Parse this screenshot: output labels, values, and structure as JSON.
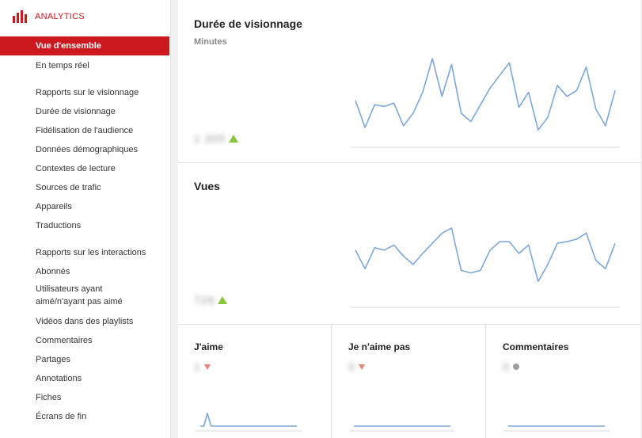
{
  "app": {
    "brand": "ANALYTICS"
  },
  "sidebar": {
    "items": [
      {
        "label": "Vue d'ensemble",
        "active": true
      },
      {
        "label": "En temps réel"
      },
      {
        "label": "Rapports sur le visionnage",
        "heading": true
      },
      {
        "label": "Durée de visionnage"
      },
      {
        "label": "Fidélisation de l'audience"
      },
      {
        "label": "Données démographiques"
      },
      {
        "label": "Contextes de lecture"
      },
      {
        "label": "Sources de trafic"
      },
      {
        "label": "Appareils"
      },
      {
        "label": "Traductions"
      },
      {
        "label": "Rapports sur les interactions",
        "heading": true
      },
      {
        "label": "Abonnés"
      },
      {
        "label": "Utilisateurs ayant aimé/n'ayant pas aimé"
      },
      {
        "label": "Vidéos dans des playlists"
      },
      {
        "label": "Commentaires"
      },
      {
        "label": "Partages"
      },
      {
        "label": "Annotations"
      },
      {
        "label": "Fiches"
      },
      {
        "label": "Écrans de fin"
      }
    ]
  },
  "cards": {
    "watch_time": {
      "title": "Durée de visionnage",
      "subtitle": "Minutes",
      "value": "1 305",
      "trend": "up"
    },
    "views": {
      "title": "Vues",
      "value": "728",
      "trend": "up"
    },
    "likes": {
      "title": "J'aime",
      "value": "1",
      "trend": "down"
    },
    "dislikes": {
      "title": "Je n'aime pas",
      "value": "0",
      "trend": "down"
    },
    "comments": {
      "title": "Commentaires",
      "value": "0",
      "trend": "neutral"
    }
  },
  "colors": {
    "accent": "#cc181e",
    "line": "#7da7d9",
    "up": "#8cc63f",
    "down": "#e9837a",
    "neutral": "#9e9e9e"
  },
  "chart_data": [
    {
      "type": "line",
      "series": [
        {
          "values": [
            50,
            18,
            45,
            43,
            47,
            20,
            35,
            60,
            100,
            55,
            93,
            35,
            25,
            45,
            65,
            80,
            95,
            42,
            60,
            15,
            30,
            68,
            55,
            62,
            90,
            40,
            20,
            62
          ]
        }
      ]
    },
    {
      "type": "line",
      "series": [
        {
          "values": [
            62,
            40,
            65,
            62,
            68,
            55,
            45,
            58,
            70,
            82,
            88,
            38,
            35,
            38,
            62,
            72,
            72,
            58,
            68,
            25,
            45,
            70,
            72,
            75,
            82,
            50,
            40,
            70
          ]
        }
      ]
    },
    {
      "type": "line",
      "series": [
        {
          "values": [
            0,
            0,
            1,
            0,
            0,
            0,
            0,
            0,
            0,
            0,
            0,
            0,
            0,
            0,
            0,
            0,
            0,
            0,
            0,
            0,
            0,
            0,
            0,
            0,
            0,
            0,
            0,
            0
          ]
        }
      ]
    },
    {
      "type": "line",
      "series": [
        {
          "values": [
            0,
            0,
            0,
            0,
            0,
            0,
            0,
            0,
            0,
            0,
            0,
            0,
            0,
            0,
            0,
            0,
            0,
            0,
            0,
            0,
            0,
            0,
            0,
            0,
            0,
            0,
            0,
            0
          ]
        }
      ]
    },
    {
      "type": "line",
      "series": [
        {
          "values": [
            0,
            0,
            0,
            0,
            0,
            0,
            0,
            0,
            0,
            0,
            0,
            0,
            0,
            0,
            0,
            0,
            0,
            0,
            0,
            0,
            0,
            0,
            0,
            0,
            0,
            0,
            0,
            0
          ]
        }
      ]
    }
  ]
}
